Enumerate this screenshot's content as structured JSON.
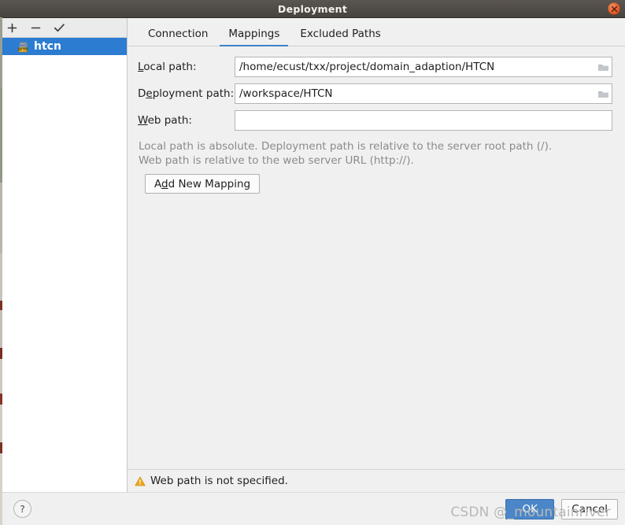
{
  "window": {
    "title": "Deployment",
    "close_icon": "close-icon"
  },
  "sidebar": {
    "toolbar": [
      {
        "name": "add-server-button",
        "icon": "plus-icon",
        "glyph": "+"
      },
      {
        "name": "remove-server-button",
        "icon": "minus-icon",
        "glyph": "−"
      },
      {
        "name": "set-default-server-button",
        "icon": "check-icon",
        "glyph": "✓"
      }
    ],
    "items": [
      {
        "label": "htcn",
        "icon": "sftp-server-icon",
        "selected": true
      }
    ]
  },
  "main": {
    "tabs": [
      {
        "label": "Connection",
        "active": false
      },
      {
        "label": "Mappings",
        "active": true
      },
      {
        "label": "Excluded Paths",
        "active": false
      }
    ],
    "fields": [
      {
        "label_pre": "",
        "label_mnemonic": "L",
        "label_post": "ocal path:",
        "value": "/home/ecust/txx/project/domain_adaption/HTCN",
        "placeholder": "",
        "has_browse": true,
        "browse_icon": "folder-icon"
      },
      {
        "label_pre": "D",
        "label_mnemonic": "e",
        "label_post": "ployment path:",
        "value": "/workspace/HTCN",
        "placeholder": "",
        "has_browse": true,
        "browse_icon": "folder-icon"
      },
      {
        "label_pre": "",
        "label_mnemonic": "W",
        "label_post": "eb path:",
        "value": "",
        "placeholder": "",
        "has_browse": false,
        "browse_icon": ""
      }
    ],
    "hint_line_1": "Local path is absolute. Deployment path is relative to the server root path (/).",
    "hint_line_2": "Web path is relative to the web server URL (http://).",
    "add_mapping": {
      "pre": "A",
      "mnemonic": "d",
      "post": "d New Mapping"
    },
    "status": {
      "icon": "warning-icon",
      "text": "Web path is not specified."
    }
  },
  "footer": {
    "help_label": "?",
    "help_icon": "question-mark-icon",
    "ok_label": "OK",
    "cancel_label": "Cancel",
    "watermark": "CSDN @_mountainriver"
  },
  "colors": {
    "accent": "#3d84cc",
    "selection": "#2c7cd1",
    "primary_button": "#4a86c8",
    "warning": "#e8a317",
    "titlebar": "#47433e",
    "panel": "#f0f0f0"
  }
}
